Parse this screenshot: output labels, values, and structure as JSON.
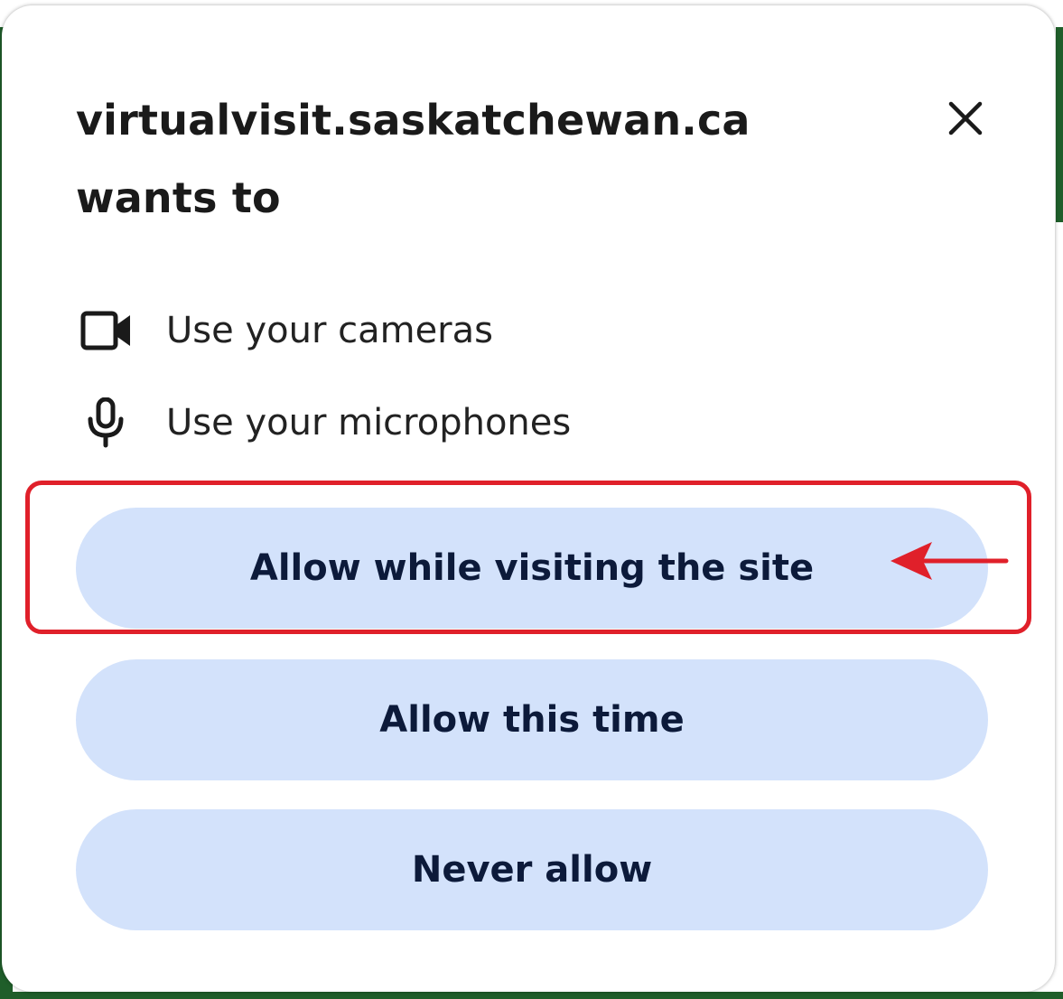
{
  "dialog": {
    "title_line1": "virtualvisit.saskatchewan.ca",
    "title_line2": "wants to",
    "close_icon": "close-icon"
  },
  "permissions": [
    {
      "icon": "camera-icon",
      "label": "Use your cameras"
    },
    {
      "icon": "microphone-icon",
      "label": "Use your microphones"
    }
  ],
  "buttons": {
    "allow_site": "Allow while visiting the site",
    "allow_once": "Allow this time",
    "never": "Never allow"
  },
  "annotation": {
    "highlight_color": "#e0202a",
    "arrow_icon": "arrow-left-icon"
  },
  "colors": {
    "button_bg": "#d3e2fb",
    "button_text": "#0c1a3a",
    "page_background": "#1f5e2a"
  }
}
